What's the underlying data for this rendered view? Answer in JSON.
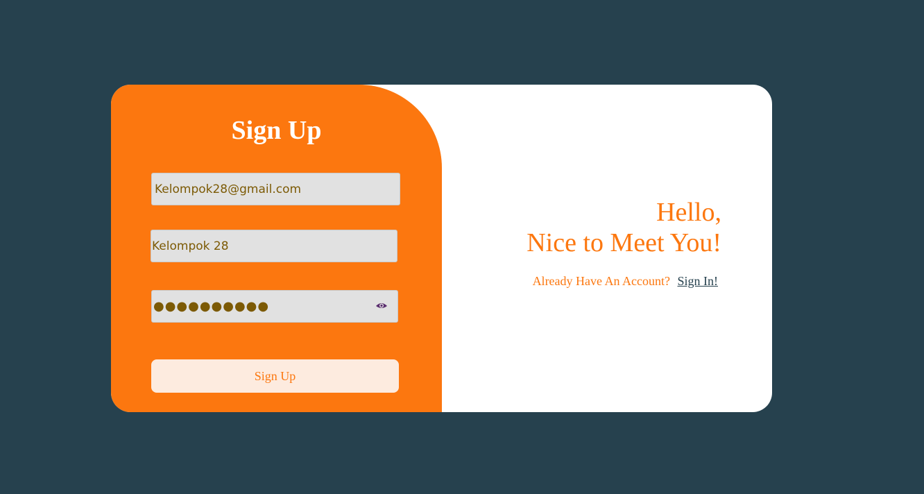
{
  "form": {
    "title": "Sign Up",
    "email_value": "Kelompok28@gmail.com",
    "name_value": "Kelompok 28",
    "password_masked": "●●●●●●●●●●",
    "submit_label": "Sign Up"
  },
  "welcome": {
    "line1": "Hello,",
    "line2": "Nice to Meet You!",
    "account_prompt": "Already Have An Account?",
    "signin_link": "Sign In!"
  },
  "colors": {
    "background": "#26414e",
    "accent": "#fc770f",
    "card": "#ffffff",
    "input_bg": "#e1e1e1",
    "input_text": "#7c5a05",
    "button_bg": "#fdebdf"
  },
  "icons": {
    "password_toggle": "eye-icon"
  }
}
